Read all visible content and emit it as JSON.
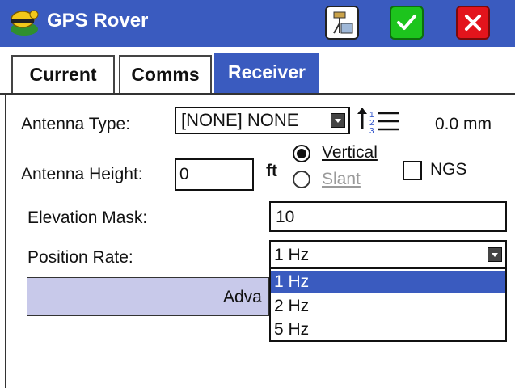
{
  "window": {
    "title": "GPS Rover",
    "title_bar_color": "#3a5bbf"
  },
  "toolbar": {
    "instrument_icon": "instrument-tripod-icon",
    "ok_icon": "checkmark-icon",
    "cancel_icon": "close-icon"
  },
  "tabs": [
    {
      "label": "Current",
      "active": false
    },
    {
      "label": "Comms",
      "active": false
    },
    {
      "label": "Receiver",
      "active": true
    }
  ],
  "form": {
    "antenna_type_label": "Antenna Type:",
    "antenna_type_value": "[NONE] NONE",
    "antenna_offset": "0.0 mm",
    "antenna_height_label": "Antenna Height:",
    "antenna_height_value": "0",
    "antenna_height_unit": "ft",
    "measure_vertical": "Vertical",
    "measure_slant": "Slant",
    "measure_selected": "Vertical",
    "ngs_label": "NGS",
    "ngs_checked": false,
    "elevation_mask_label": "Elevation Mask:",
    "elevation_mask_value": "10",
    "position_rate_label": "Position Rate:",
    "position_rate_value": "1 Hz",
    "position_rate_options": [
      "1 Hz",
      "2 Hz",
      "5 Hz"
    ],
    "advanced_label_visible": "Adva"
  }
}
